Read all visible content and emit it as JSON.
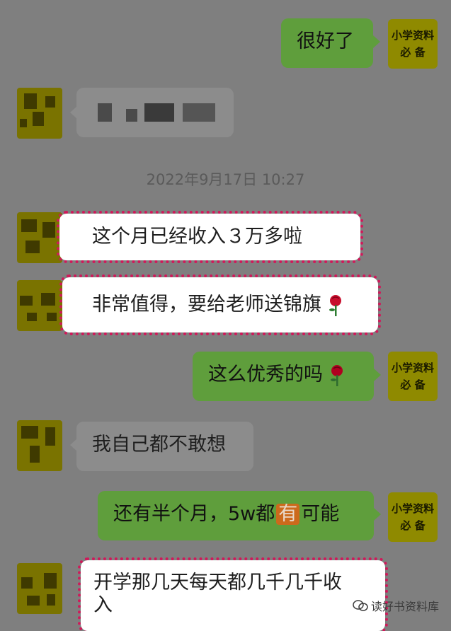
{
  "chat": {
    "timestamp": "2022年9月17日 10:27",
    "messages": [
      {
        "sender": "self",
        "text": "很好了"
      },
      {
        "sender": "other",
        "text": ""
      },
      {
        "sender": "other",
        "text": "这个月已经收入３万多啦"
      },
      {
        "sender": "other",
        "text": "非常值得，要给老师送锦旗"
      },
      {
        "sender": "self",
        "text": "这么优秀的吗"
      },
      {
        "sender": "other",
        "text": "我自己都不敢想"
      },
      {
        "sender": "self",
        "text_before": "还有半个月，5w都",
        "badge": "有",
        "text_after": "可能"
      },
      {
        "sender": "other",
        "text_line1": "开学那几天每天都几千几千收",
        "text_line2": "入"
      }
    ]
  },
  "self_avatar": {
    "line1": "小学资料",
    "line2": "必 备"
  },
  "watermark": "读好书资料库",
  "colors": {
    "background": "#7f7f7f",
    "green_bubble": "#5f9e3c",
    "highlight": "#d0195a"
  },
  "icons": [
    "rose-emoji-icon",
    "wechat-logo-icon"
  ]
}
